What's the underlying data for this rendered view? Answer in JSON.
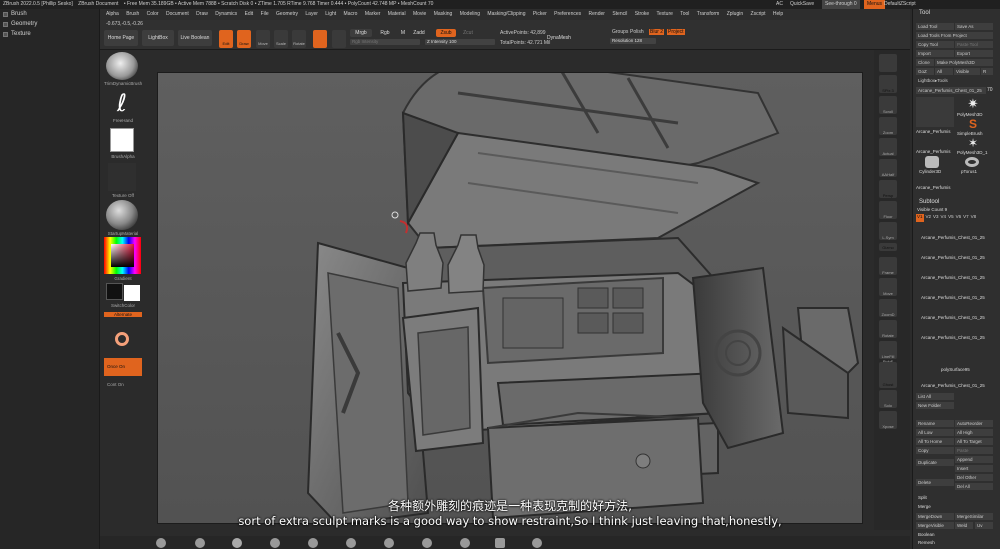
{
  "titlebar": {
    "app_title": "ZBrush 2022.0.5 [Phillip Sesko]",
    "document": "ZBrush Document",
    "stats": "• Free Mem 35.189GB • Active Mem 7888 • Scratch Disk 0 • ZTime 1.705 RTime 9.768 Timer 0.444 • PolyCount 42.748 MP • MeshCount 70",
    "ac": "AC",
    "quicksave": "QuickSave",
    "see_through": "See-through 0",
    "menus": "Menus",
    "default_script": "DefaultZScript"
  },
  "menubar": {
    "items": [
      "Alpha",
      "Brush",
      "Color",
      "Document",
      "Draw",
      "Dynamics",
      "Edit",
      "File",
      "Geometry",
      "Layer",
      "Light",
      "Macro",
      "Marker",
      "Material",
      "Movie",
      "Masking",
      "Modeling",
      "Masking/Clipping",
      "Picker",
      "Preferences",
      "Render",
      "Stencil",
      "Stroke",
      "Texture",
      "Tool",
      "Transform",
      "Zplugin",
      "Zscript",
      "Help"
    ]
  },
  "left_tray": {
    "items": [
      "Brush",
      "Geometry",
      "Texture"
    ]
  },
  "shelf": {
    "coords": "-0.673,-0.5,-0.26",
    "home_page": "Home Page",
    "lightbox": "LightBox",
    "live_boolean": "Live Boolean",
    "edit": "Edit",
    "draw": "Draw",
    "move": "Move",
    "scale": "Scale",
    "rotate": "Rotate",
    "mrgb": "Mrgb",
    "rgb": "Rgb",
    "m": "M",
    "zadd": "Zadd",
    "zsub": "Zsub",
    "zcut": "Zcut",
    "rgb_intensity": "Rgb Intensity",
    "z_intensity": "Z Intensity 100",
    "active_points": "ActivePoints: 42,899",
    "total_points": "TotalPoints: 42.721 Mil",
    "dynamesh": "DynaMesh",
    "groups": "Groups",
    "polish": "Polish",
    "blur": "Blur 2",
    "project": "Project",
    "resolution": "Resolution 128"
  },
  "left_shelf": {
    "brush": "TrimDynamicBrush",
    "stroke": "FreeHand",
    "alpha": "BrushAlpha",
    "texture": "Texture Off",
    "material": "StartupMaterial",
    "gradient": "Gradient",
    "switch_color": "SwitchColor",
    "alternate": "Alternate",
    "once_on": "Once On",
    "cont_on": "Cont On"
  },
  "right_shelf": {
    "items": [
      "SPix 3",
      "Scroll",
      "Zoom",
      "Actual",
      "AAHalf",
      "Persp",
      "Floor",
      "L.Sym",
      "Gizmo",
      "Frame",
      "Move",
      "ZoomD",
      "Rotate",
      "LineFill PolyF",
      "Transp",
      "Ghost",
      "Solo",
      "Xpose"
    ]
  },
  "tool_panel": {
    "title": "Tool",
    "load_tool": "Load Tool",
    "save_as": "Save As",
    "load_from_project": "Load Tools From Project",
    "copy_tool": "Copy Tool",
    "paste_tool": "Paste Tool",
    "import": "Import",
    "export": "Export",
    "clone": "Clone",
    "make_polymesh": "Make PolyMesh3D",
    "goz": "GoZ",
    "all": "All",
    "visible": "Visible",
    "r": "R",
    "lightbox_tools": "Lightbox▸Tools",
    "current_tool": "Arcane_Perfumis_Chest_01_25",
    "count": "70",
    "thumbs": [
      "Arcane_Perfumis",
      "PolyMesh3D",
      "SimpleBrush",
      "Arcane_Perfumis",
      "PolyMesh3D_1",
      "Cylinder3D",
      "pTorus1",
      "Arcane_Perfumis"
    ],
    "subtool_title": "Subtool",
    "visible_count": "Visible Count 9",
    "v_tabs": [
      "V1",
      "V2",
      "V3",
      "V4",
      "V5",
      "V6",
      "V7",
      "V8"
    ],
    "subtools": [
      "Arcane_Perfumis_Chest_01_25",
      "Arcane_Perfumis_Chest_01_25",
      "Arcane_Perfumis_Chest_01_25",
      "Arcane_Perfumis_Chest_01_25",
      "Arcane_Perfumis_Chest_01_25",
      "Arcane_Perfumis_Chest_01_25",
      "polySurface95",
      "Arcane_Perfumis_Chest_01_25"
    ],
    "list_all": "List All",
    "new_folder": "New Folder",
    "rename": "Rename",
    "auto_reorder": "AutoReorder",
    "all_low": "All Low",
    "all_high": "All High",
    "all_to_home": "All To Home",
    "all_to_target": "All To Target",
    "copy": "Copy",
    "paste": "Paste",
    "duplicate": "Duplicate",
    "append": "Append",
    "insert": "Insert",
    "delete": "Delete",
    "del_other": "Del Other",
    "del_all": "Del All",
    "split": "Split",
    "merge": "Merge",
    "merge_down": "MergeDown",
    "merge_similar": "MergeSimilar",
    "merge_visible": "MergeVisible",
    "weld": "Weld",
    "uv": "Uv",
    "boolean": "Boolean",
    "remesh": "Remesh",
    "project_bas": "Project BasRelief",
    "pnts": "Pnts Pro"
  },
  "subtitles": {
    "line1": "各种额外雕刻的痕迹是一种表现克制的好方法,",
    "line2": "sort of extra sculpt marks is a good way to show restraint,So I think just leaving that,honestly,"
  },
  "colors": {
    "accent": "#e0641e",
    "canvas_bg": "#5a5a5a",
    "model_mid": "#6e6e6e"
  }
}
